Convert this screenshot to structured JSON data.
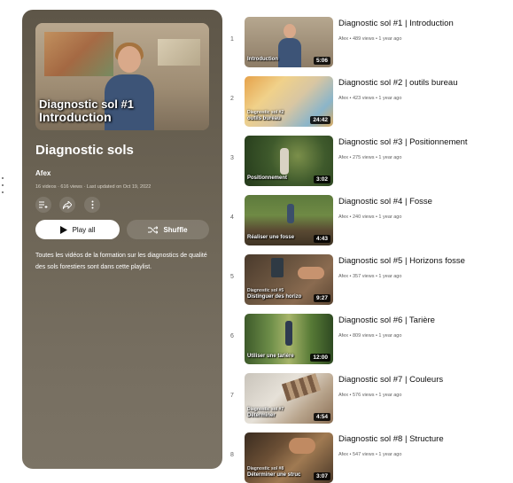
{
  "playlist": {
    "cover_line1": "Diagnostic sol #1",
    "cover_line2": "Introduction",
    "title": "Diagnostic sols",
    "owner": "Afex",
    "meta": "16 videos · 616 views · Last updated on Oct 19, 2022",
    "play_all_label": "Play all",
    "shuffle_label": "Shuffle",
    "description": "Toutes les vidéos de la formation sur les diagnostics de qualité des sols forestiers sont dans cette playlist."
  },
  "videos": [
    {
      "index": "1",
      "title": "Diagnostic sol #1 | Introduction",
      "meta": "Afex • 489 views • 1 year ago",
      "duration": "5:06",
      "overlay": "Introduction",
      "overlay2": ""
    },
    {
      "index": "2",
      "title": "Diagnostic sol #2 | outils bureau",
      "meta": "Afex • 423 views • 1 year ago",
      "duration": "24:42",
      "overlay": "outils bureau",
      "overlay2": "Diagnostic sol #2"
    },
    {
      "index": "3",
      "title": "Diagnostic sol #3 | Positionnement",
      "meta": "Afex • 275 views • 1 year ago",
      "duration": "3:02",
      "overlay": "Positionnement",
      "overlay2": ""
    },
    {
      "index": "4",
      "title": "Diagnostic sol #4 | Fosse",
      "meta": "Afex • 240 views • 1 year ago",
      "duration": "4:43",
      "overlay": "Réaliser une fosse",
      "overlay2": ""
    },
    {
      "index": "5",
      "title": "Diagnostic sol #5 | Horizons fosse",
      "meta": "Afex • 357 views • 1 year ago",
      "duration": "9:27",
      "overlay": "Distinguer des horizo",
      "overlay2": "Diagnostic sol #5"
    },
    {
      "index": "6",
      "title": "Diagnostic sol #6 | Tarière",
      "meta": "Afex • 809 views • 1 year ago",
      "duration": "12:00",
      "overlay": "Utiliser une tarière",
      "overlay2": ""
    },
    {
      "index": "7",
      "title": "Diagnostic sol #7 | Couleurs",
      "meta": "Afex • 576 views • 1 year ago",
      "duration": "4:54",
      "overlay": "Déterminer",
      "overlay2": "Diagnostic sol #7"
    },
    {
      "index": "8",
      "title": "Diagnostic sol #8 | Structure",
      "meta": "Afex • 547 views • 1 year ago",
      "duration": "3:07",
      "overlay": "Déterminer une struc",
      "overlay2": "Diagnostic sol #8"
    }
  ]
}
